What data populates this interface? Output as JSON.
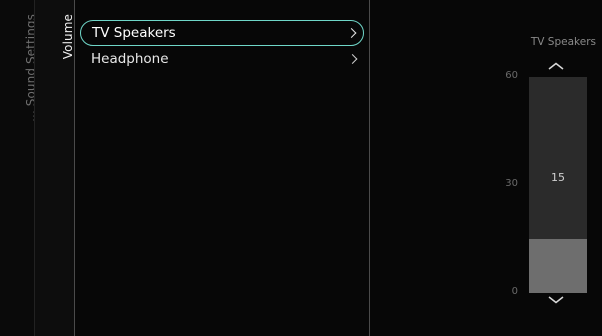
{
  "breadcrumb": {
    "parent": "... Sound Settings",
    "current": "Volume"
  },
  "menu": {
    "items": [
      {
        "label": "TV Speakers",
        "selected": true
      },
      {
        "label": "Headphone",
        "selected": false
      }
    ]
  },
  "slider": {
    "title": "TV Speakers",
    "value": 15,
    "value_text": "15",
    "min": 0,
    "max": 60,
    "ticks": [
      {
        "value": 60,
        "label": "60"
      },
      {
        "value": 30,
        "label": "30"
      },
      {
        "value": 0,
        "label": "0"
      }
    ],
    "up_icon": "chevron-up-icon",
    "down_icon": "chevron-down-icon"
  },
  "colors": {
    "focus_outline": "#6fd6c8",
    "track": "#2b2b2b",
    "fill": "#6e6e6e",
    "background": "#070707"
  }
}
